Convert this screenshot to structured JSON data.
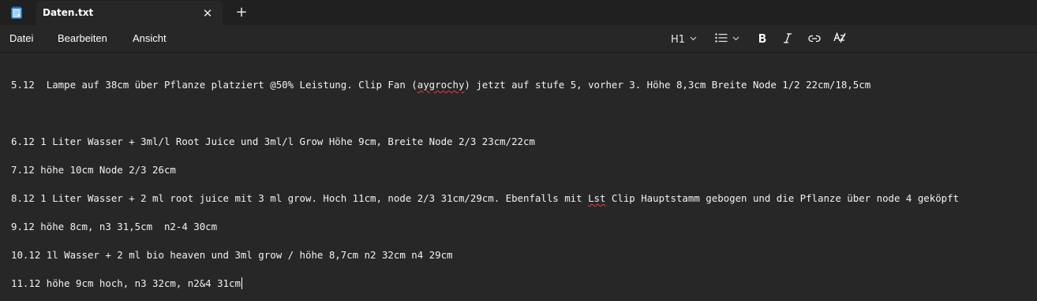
{
  "tab": {
    "title": "Daten.txt",
    "close_glyph": "✕",
    "new_tab_glyph": "+"
  },
  "menu": {
    "file": "Datei",
    "edit": "Bearbeiten",
    "view": "Ansicht"
  },
  "toolbar": {
    "heading_label": "H1",
    "icons": [
      "heading-dropdown",
      "list-icon",
      "bold-icon",
      "italic-icon",
      "link-icon",
      "clear-formatting-icon"
    ]
  },
  "document": {
    "lines": [
      {
        "pre": "5.12  Lampe auf 38cm über Pflanze platziert @50% Leistung. Clip Fan (",
        "flag": "aygrochy",
        "post": ") jetzt auf stufe 5, vorher 3. Höhe 8,3cm Breite Node 1/2 22cm/18,5cm"
      },
      {
        "text": ""
      },
      {
        "text": "6.12 1 Liter Wasser + 3ml/l Root Juice und 3ml/l Grow Höhe 9cm, Breite Node 2/3 23cm/22cm"
      },
      {
        "text": "7.12 höhe 10cm Node 2/3 26cm"
      },
      {
        "pre": "8.12 1 Liter Wasser + 2 ml root juice mit 3 ml grow. Hoch 11cm, node 2/3 31cm/29cm. Ebenfalls mit ",
        "flag": "Lst",
        "post": " Clip Hauptstamm gebogen und die Pflanze über node 4 geköpft"
      },
      {
        "text": "9.12 höhe 8cm, n3 31,5cm  n2-4 30cm"
      },
      {
        "text": "10.12 1l Wasser + 2 ml bio heaven und 3ml grow / höhe 8,7cm n2 32cm n4 29cm"
      },
      {
        "text": "11.12 höhe 9cm hoch, n3 32cm, n2&4 31cm"
      }
    ]
  },
  "colors": {
    "background": "#272727",
    "titlebar": "#202020",
    "text": "#f2f2f2",
    "spellcheck": "#e04040"
  }
}
